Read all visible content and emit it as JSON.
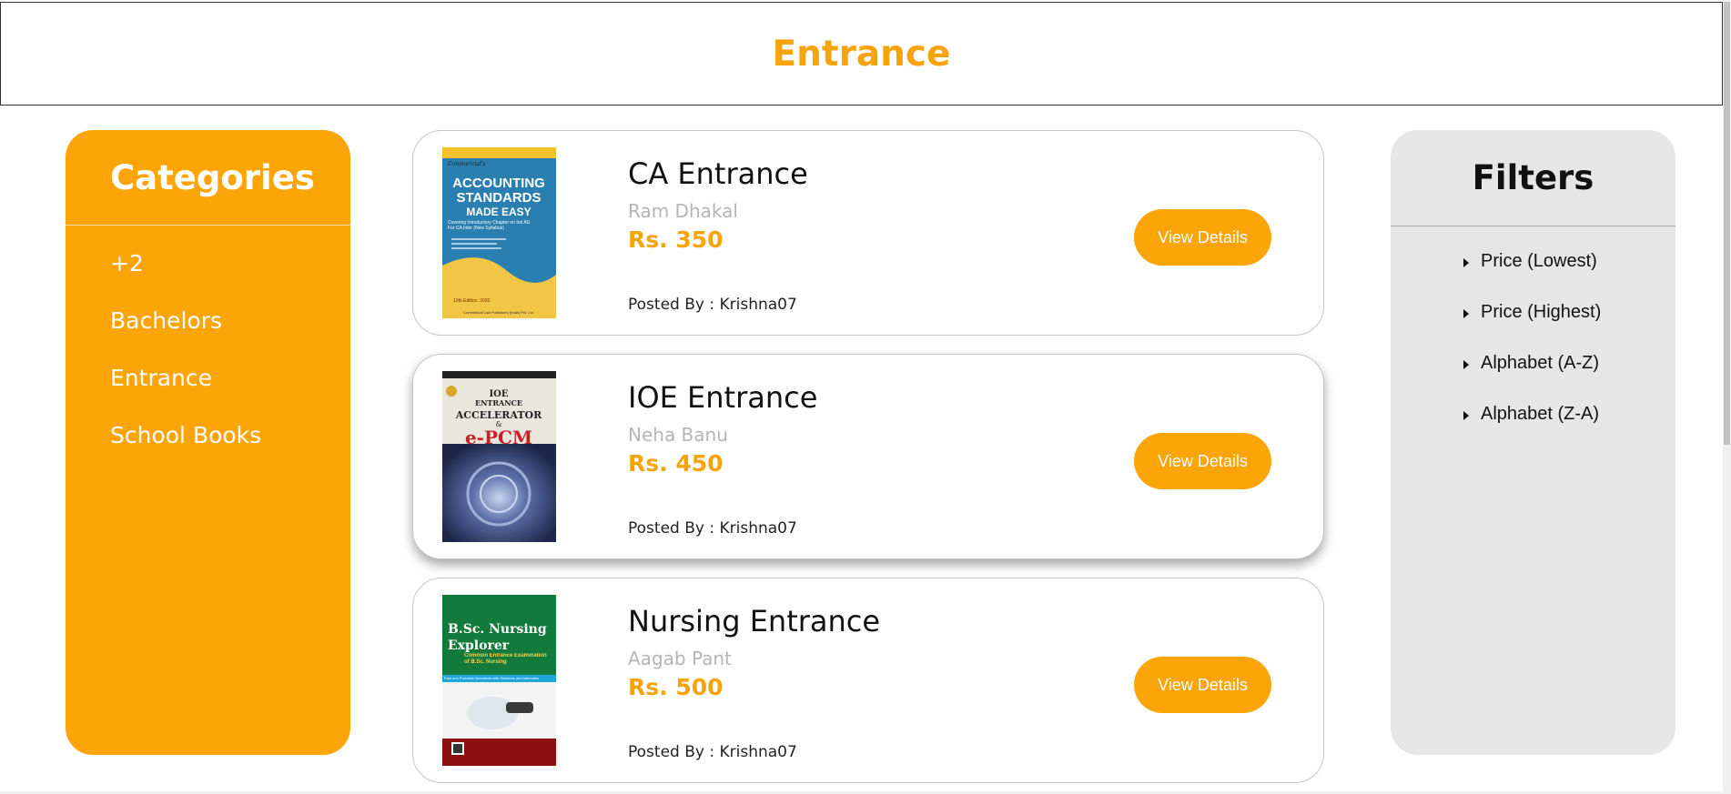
{
  "header": {
    "title": "Entrance"
  },
  "categories": {
    "title": "Categories",
    "items": [
      "+2",
      "Bachelors",
      "Entrance",
      "School Books"
    ]
  },
  "books": [
    {
      "name": "CA Entrance",
      "author": "Ram Dhakal",
      "price": "Rs. 350",
      "posted_by": "Posted By : Krishna07",
      "button": "View Details",
      "cover": {
        "publisher": "Commercial's",
        "title_lines": [
          "ACCOUNTING",
          "STANDARDS",
          "MADE EASY"
        ],
        "subtitle": "Covering Introductory Chapter on Ind AS For CA Inter (New Syllabus)",
        "edition": "12th Edition, 2020",
        "footer": "Commercial Law Publishers (India) Pvt. Ltd."
      }
    },
    {
      "name": "IOE Entrance",
      "author": "Neha Banu",
      "price": "Rs. 450",
      "posted_by": "Posted By : Krishna07",
      "button": "View Details",
      "cover": {
        "title_lines": [
          "IOE",
          "ENTRANCE",
          "ACCELERATOR",
          "&"
        ],
        "big": "e-PCM"
      }
    },
    {
      "name": "Nursing Entrance",
      "author": "Aagab Pant",
      "price": "Rs. 500",
      "posted_by": "Posted By : Krishna07",
      "button": "View Details",
      "cover": {
        "title_lines": [
          "B.Sc. Nursing",
          "Explorer"
        ],
        "subtitle": "Common Entrance Examination of B.Sc. Nursing",
        "strip": "Past and Probable Questions with Solutions and rationales"
      }
    }
  ],
  "filters": {
    "title": "Filters",
    "items": [
      "Price (Lowest)",
      "Price (Highest)",
      "Alphabet (A-Z)",
      "Alphabet (Z-A)"
    ]
  },
  "colors": {
    "accent": "#fca408",
    "accent_text": "#f7a30a",
    "filters_panel": "#e6e6e6",
    "muted_text": "#b5b5b5"
  }
}
